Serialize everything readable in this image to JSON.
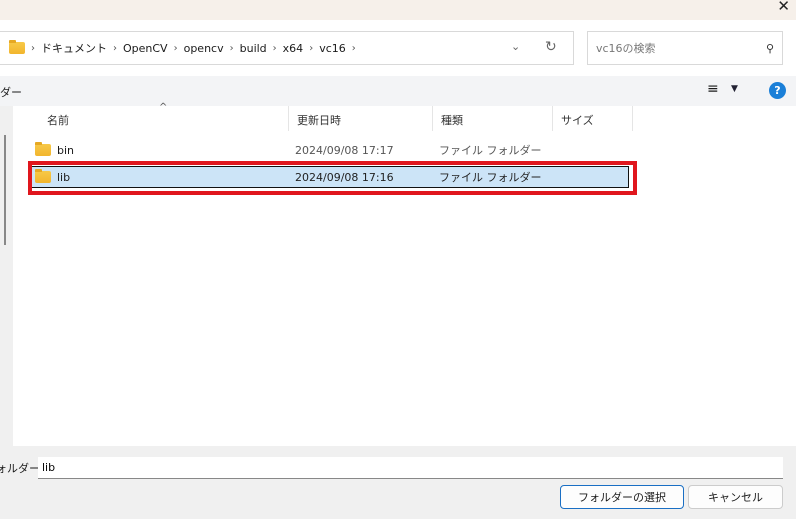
{
  "breadcrumb": [
    "ドキュメント",
    "OpenCV",
    "opencv",
    "build",
    "x64",
    "vc16"
  ],
  "search": {
    "placeholder": "vc16の検索"
  },
  "toolbar": {
    "left_label": "ダー"
  },
  "columns": {
    "name": "名前",
    "date": "更新日時",
    "type": "種類",
    "size": "サイズ"
  },
  "rows": [
    {
      "name": "bin",
      "date": "2024/09/08 17:17",
      "type": "ファイル フォルダー"
    },
    {
      "name": "lib",
      "date": "2024/09/08 17:16",
      "type": "ファイル フォルダー"
    }
  ],
  "footer": {
    "folder_label": "ォルダー:",
    "folder_value": "lib",
    "select_button": "フォルダーの選択",
    "cancel_button": "キャンセル"
  }
}
